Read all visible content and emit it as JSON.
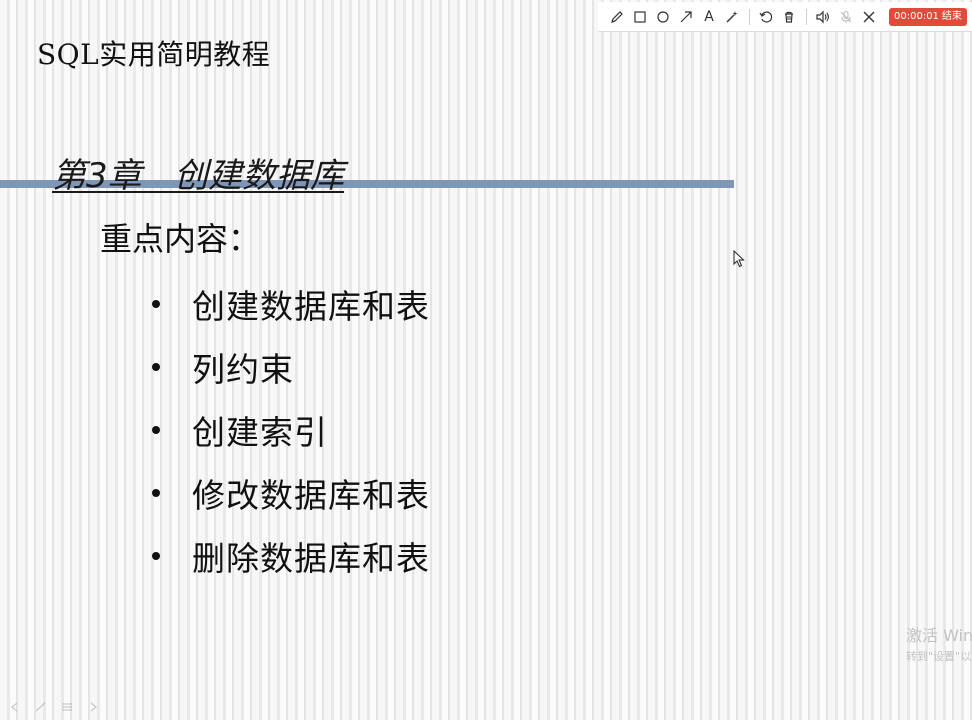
{
  "slide": {
    "course_title": "SQL实用简明教程",
    "chapter_title": "第3章   创建数据库",
    "key_points_label": "重点内容：",
    "bullets": [
      "创建数据库和表",
      "列约束",
      "创建索引",
      "修改数据库和表",
      "删除数据库和表"
    ]
  },
  "toolbar": {
    "tools": [
      "pencil-icon",
      "rectangle-icon",
      "circle-icon",
      "arrow-icon",
      "text-icon",
      "magic-wand-icon",
      "undo-icon",
      "trash-icon",
      "speaker-icon",
      "microphone-muted-icon",
      "close-icon"
    ],
    "text_tool_label": "A",
    "timer": "00:00:01",
    "end_label": "结束",
    "timer_color": "#e24b3c"
  },
  "watermark": {
    "line1": "激活 Win",
    "line2": "转到\"设置\"以"
  },
  "colors": {
    "chapter_bar": "#7f96b8"
  }
}
